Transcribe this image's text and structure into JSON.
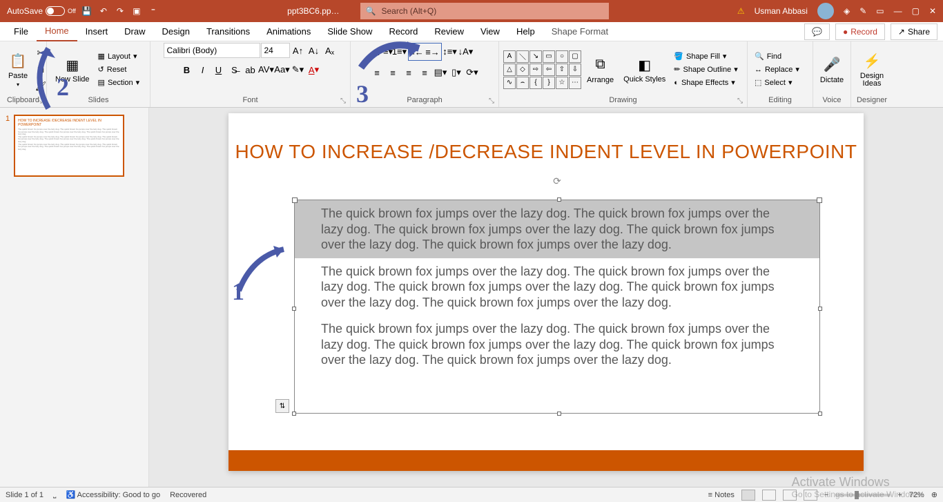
{
  "titleBar": {
    "autosave": "AutoSave",
    "autosaveState": "Off",
    "fileName": "ppt3BC6.pp…",
    "searchPlaceholder": "Search (Alt+Q)",
    "userName": "Usman Abbasi"
  },
  "menuTabs": {
    "file": "File",
    "home": "Home",
    "insert": "Insert",
    "draw": "Draw",
    "design": "Design",
    "transitions": "Transitions",
    "animations": "Animations",
    "slideShow": "Slide Show",
    "record": "Record",
    "review": "Review",
    "view": "View",
    "help": "Help",
    "shapeFormat": "Shape Format",
    "recordBtn": "Record",
    "share": "Share"
  },
  "ribbon": {
    "clipboard": {
      "label": "Clipboard",
      "paste": "Paste"
    },
    "slides": {
      "label": "Slides",
      "newSlide": "New Slide",
      "layout": "Layout",
      "reset": "Reset",
      "section": "Section"
    },
    "font": {
      "label": "Font",
      "fontName": "Calibri (Body)",
      "fontSize": "24"
    },
    "paragraph": {
      "label": "Paragraph"
    },
    "drawing": {
      "label": "Drawing",
      "arrange": "Arrange",
      "quickStyles": "Quick Styles",
      "shapeFill": "Shape Fill",
      "shapeOutline": "Shape Outline",
      "shapeEffects": "Shape Effects"
    },
    "editing": {
      "label": "Editing",
      "find": "Find",
      "replace": "Replace",
      "select": "Select"
    },
    "voice": {
      "label": "Voice",
      "dictate": "Dictate"
    },
    "designer": {
      "label": "Designer",
      "designIdeas": "Design Ideas"
    }
  },
  "slide": {
    "title": "HOW TO INCREASE /DECREASE INDENT LEVEL IN POWERPOINT",
    "para1": "The quick brown fox jumps over the lazy dog. The quick brown fox jumps over the lazy dog. The quick brown fox jumps over the lazy dog. The quick brown fox jumps over the lazy dog. The quick brown fox jumps over the lazy dog.",
    "para2": "The quick brown fox jumps over the lazy dog. The quick brown fox jumps over the lazy dog. The quick brown fox jumps over the lazy dog. The quick brown fox jumps over the lazy dog. The quick brown fox jumps over the lazy dog.",
    "para3": "The quick brown fox jumps over the lazy dog. The quick brown fox jumps over the lazy dog. The quick brown fox jumps over the lazy dog. The quick brown fox jumps over the lazy dog. The quick brown fox jumps over the lazy dog."
  },
  "thumbs": {
    "num1": "1"
  },
  "annotations": {
    "n1": "1",
    "n2": "2",
    "n3": "3"
  },
  "watermark": {
    "title": "Activate Windows",
    "sub": "Go to Settings to activate Windows."
  },
  "status": {
    "slideCount": "Slide 1 of 1",
    "accessibility": "Accessibility: Good to go",
    "recovered": "Recovered",
    "notes": "Notes",
    "zoom": "72%"
  }
}
